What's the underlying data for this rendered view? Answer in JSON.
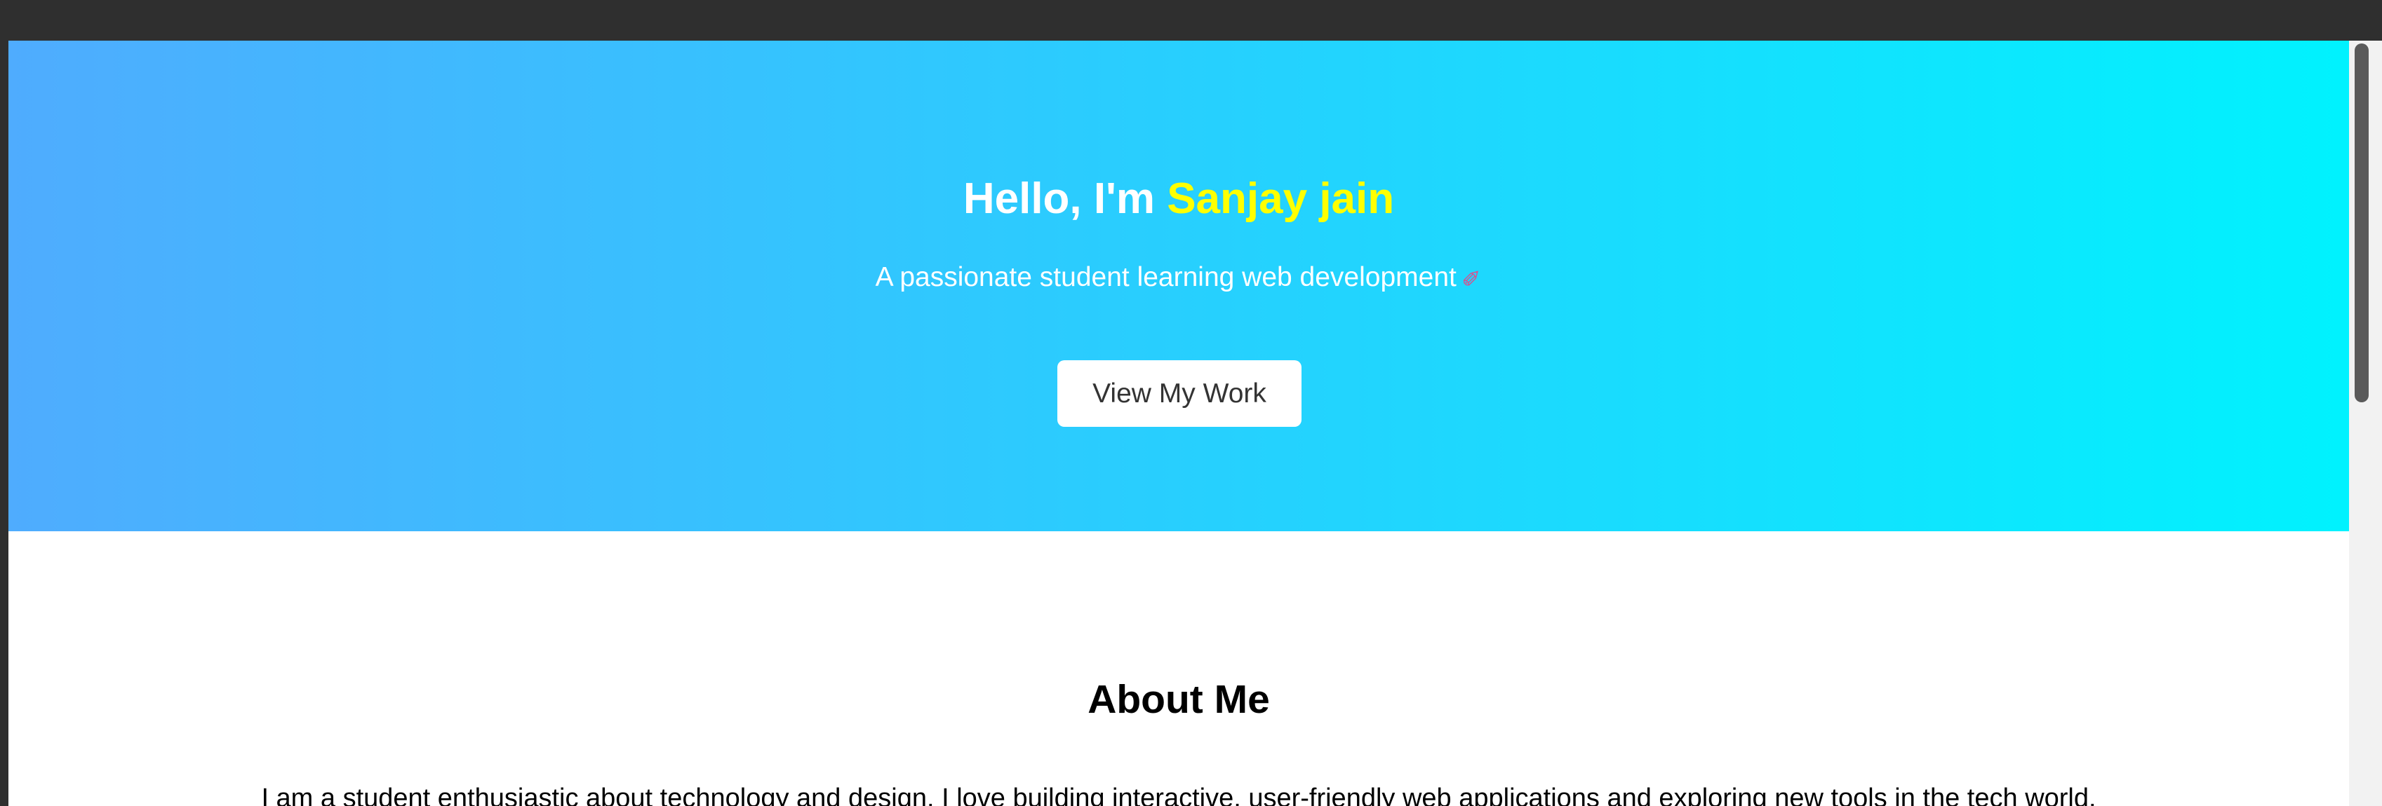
{
  "hero": {
    "greeting": "Hello, I'm ",
    "name": "Sanjay jain",
    "subtitle": "A passionate student learning web development",
    "subtitle_icon": "rocket-icon",
    "cta_label": "View My Work",
    "gradient_start": "#4facfe",
    "gradient_end": "#00f2fe",
    "name_color": "#ffff00"
  },
  "about": {
    "title": "About Me",
    "text": "I am a student enthusiastic about technology and design. I love building interactive, user-friendly web applications and exploring new tools in the tech world."
  }
}
